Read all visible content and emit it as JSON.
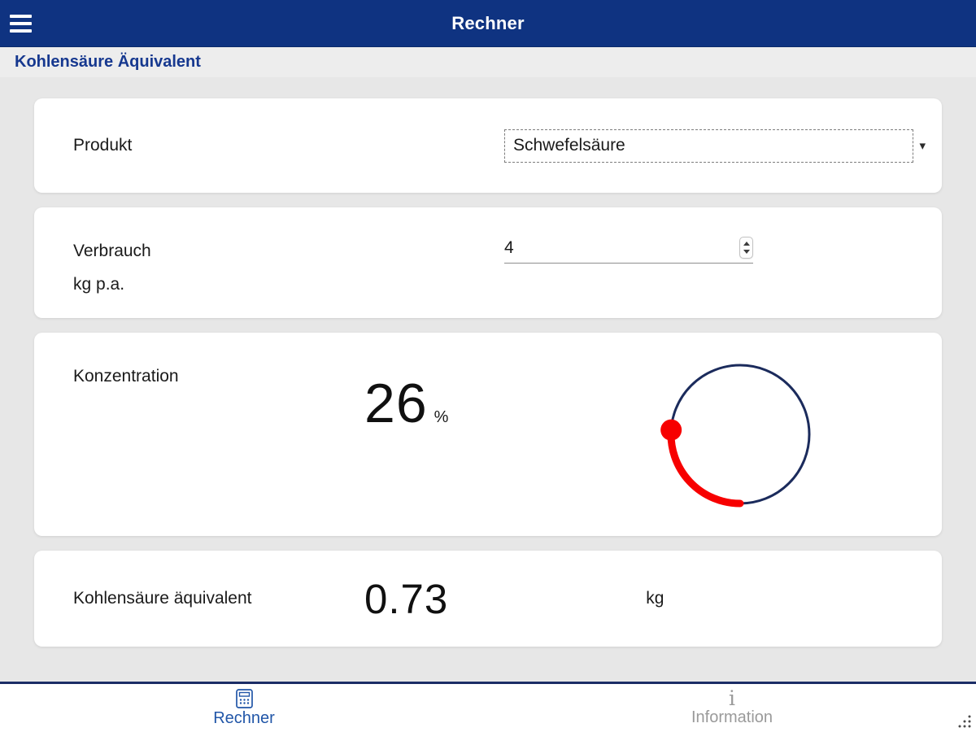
{
  "header": {
    "title": "Rechner"
  },
  "subheader": {
    "title": "Kohlensäure Äquivalent"
  },
  "form": {
    "produkt": {
      "label": "Produkt",
      "value": "Schwefelsäure"
    },
    "verbrauch": {
      "label": "Verbrauch",
      "sublabel": "kg p.a.",
      "value": "4"
    },
    "konzentration": {
      "label": "Konzentration",
      "value": "26",
      "unit": "%",
      "percent": 26
    },
    "result": {
      "label": "Kohlensäure äquivalent",
      "value": "0.73",
      "unit": "kg"
    }
  },
  "tabbar": {
    "tabs": [
      {
        "id": "rechner",
        "label": "Rechner",
        "icon": "calculator-icon",
        "active": true
      },
      {
        "id": "information",
        "label": "Information",
        "icon": "info-icon",
        "active": false
      }
    ]
  },
  "colors": {
    "header_bg": "#0f3381",
    "subheader_text": "#16388f",
    "active_tab": "#2156a8",
    "inactive_tab": "#9a9a9a",
    "dial_track": "#1b2b5c",
    "dial_value": "#f70000"
  }
}
